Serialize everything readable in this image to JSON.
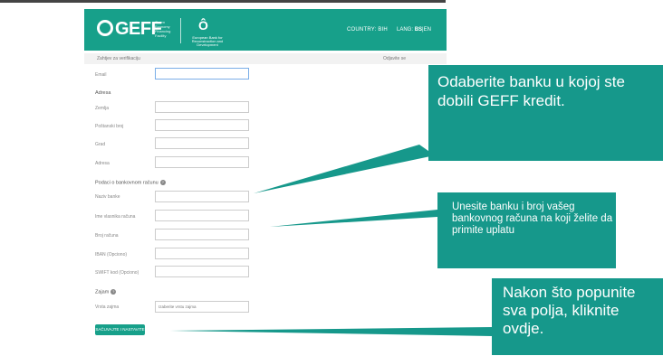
{
  "header": {
    "brand": "GEFF",
    "brand_tagline": "Green Economy Financing Facility",
    "ebrd_name": "European Bank for Reconstruction and Development",
    "country": "COUNTRY: BIH",
    "lang_label": "LANG:",
    "lang_active": "BS",
    "lang_sep": "|",
    "lang_other": "EN"
  },
  "subbar": {
    "breadcrumb": "Zahtjev za verifikaciju",
    "logout": "Odjavite se"
  },
  "form": {
    "email_label": "Email",
    "address_section": "Adresa",
    "country_label": "Zemlja",
    "postal_label": "Poštanski broj",
    "city_label": "Grad",
    "address_label": "Adresa",
    "bank_section": "Podaci o bankovnom računu",
    "bank_name_label": "Naziv banke",
    "account_owner_label": "Ime vlasnika računa",
    "account_number_label": "Broj računa",
    "iban_label": "IBAN (Opciono)",
    "swift_label": "SWIFT kod (Opciono)",
    "loan_section": "Zajam",
    "loan_type_label": "Vrsta zajma",
    "loan_type_value": "Izaberite vrstu zajma",
    "submit_label": "SAČUVAJTE I NASTAVITE"
  },
  "callouts": {
    "bank_select": "Odaberite banku u kojoj ste dobili GEFF kredit.",
    "bank_account": "Unesite banku i broj vašeg bankovnog računa na koji želite da primite uplatu",
    "submit_hint": "Nakon što popunite sva polja, kliknite ovdje."
  },
  "colors": {
    "brand_teal": "#17a08a",
    "callout_teal": "#16988b"
  },
  "icons": {
    "info": "info-circle-icon"
  }
}
